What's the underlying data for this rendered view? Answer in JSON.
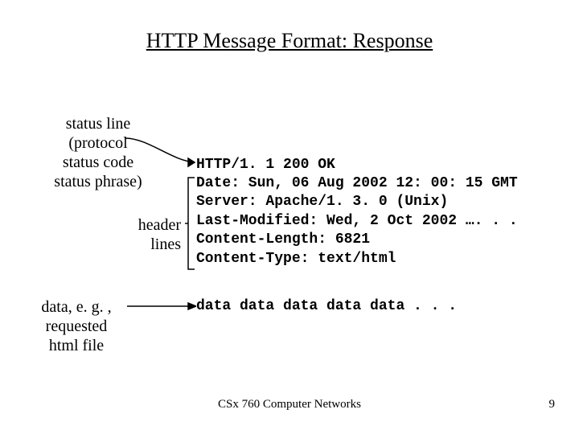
{
  "title": "HTTP Message Format: Response",
  "labels": {
    "status_line": "status line\n(protocol\nstatus code\nstatus phrase)",
    "header_lines": "header\nlines",
    "data_label": "data, e. g. ,\nrequested\nhtml file"
  },
  "response": {
    "status": "HTTP/1. 1 200 OK",
    "headers": "Date: Sun, 06 Aug 2002 12: 00: 15 GMT\nServer: Apache/1. 3. 0 (Unix)\nLast-Modified: Wed, 2 Oct 2002 …. . .\nContent-Length: 6821\nContent-Type: text/html",
    "data": "data data data data data . . ."
  },
  "footer": {
    "course": "CSx 760 Computer Networks",
    "page": "9"
  }
}
